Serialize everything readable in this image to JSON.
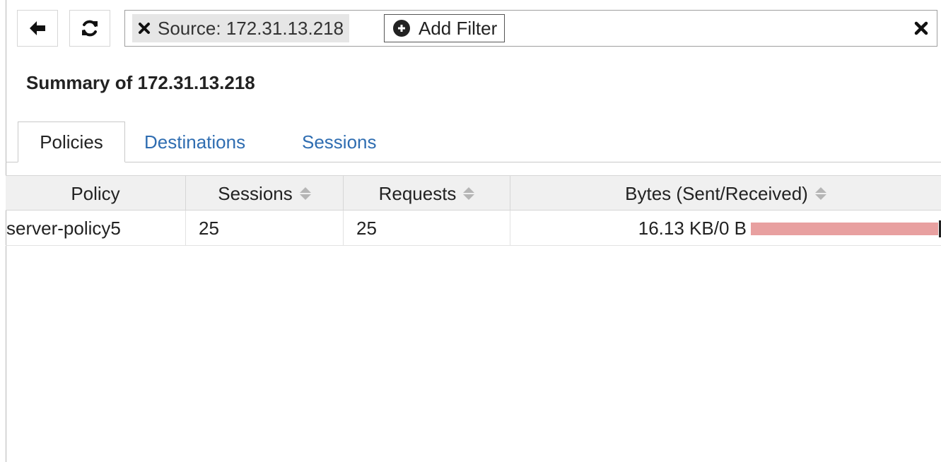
{
  "toolbar": {
    "back_icon": "arrow-left-icon",
    "refresh_icon": "refresh-icon"
  },
  "filter": {
    "chip_label": "Source: 172.31.13.218",
    "add_filter_label": "Add Filter",
    "clear_icon": "close-icon"
  },
  "summary": {
    "title": "Summary of 172.31.13.218"
  },
  "tabs": [
    {
      "label": "Policies",
      "active": true
    },
    {
      "label": "Destinations",
      "active": false
    },
    {
      "label": "Sessions",
      "active": false
    }
  ],
  "table": {
    "columns": [
      {
        "label": "Policy",
        "sortable": false
      },
      {
        "label": "Sessions",
        "sortable": true
      },
      {
        "label": "Requests",
        "sortable": true
      },
      {
        "label": "Bytes (Sent/Received)",
        "sortable": true
      }
    ],
    "rows": [
      {
        "policy": "server-policy5",
        "sessions": "25",
        "requests": "25",
        "bytes": "16.13 KB/0 B",
        "sent_fraction": 1.0,
        "received_fraction": 0.0
      }
    ]
  },
  "colors": {
    "link": "#2f6db1",
    "bar_sent": "#e8a0a0",
    "bar_received": "#222222"
  }
}
